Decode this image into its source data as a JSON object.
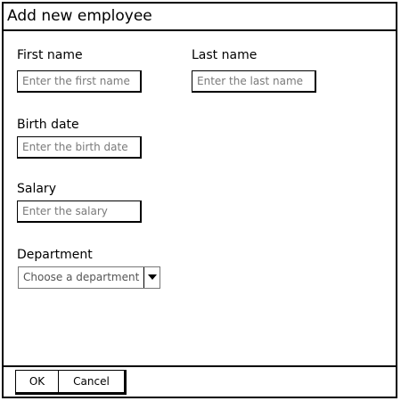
{
  "window": {
    "title": "Add new employee"
  },
  "form": {
    "first_name": {
      "label": "First name",
      "placeholder": "Enter the first name",
      "value": ""
    },
    "last_name": {
      "label": "Last name",
      "placeholder": "Enter the last name",
      "value": ""
    },
    "birth_date": {
      "label": "Birth date",
      "placeholder": "Enter the birth date",
      "value": ""
    },
    "salary": {
      "label": "Salary",
      "placeholder": "Enter the salary",
      "value": ""
    },
    "department": {
      "label": "Department",
      "selected": "Choose a department",
      "icon": "chevron-down-icon"
    }
  },
  "buttons": {
    "ok_label": "OK",
    "cancel_label": "Cancel"
  }
}
